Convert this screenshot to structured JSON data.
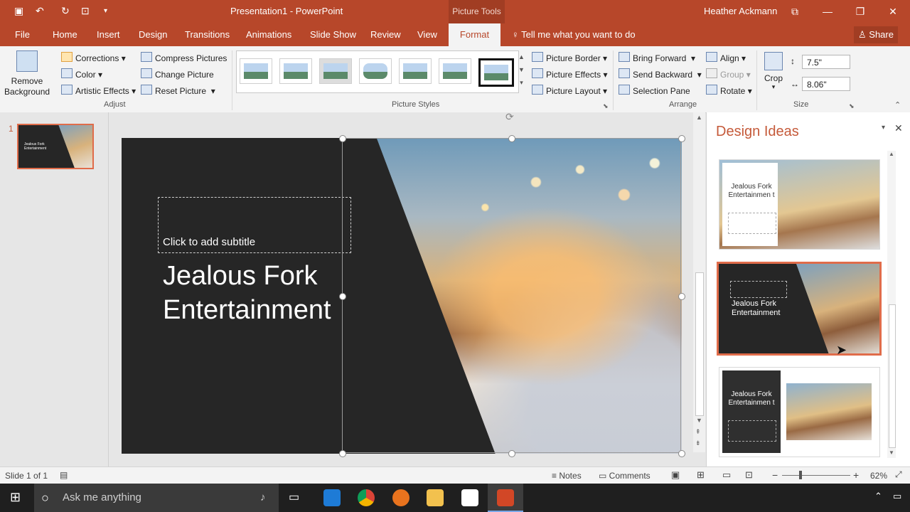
{
  "window": {
    "doc_title": "Presentation1 - PowerPoint",
    "context_tab": "Picture Tools",
    "user": "Heather Ackmann"
  },
  "tabs": [
    "File",
    "Home",
    "Insert",
    "Design",
    "Transitions",
    "Animations",
    "Slide Show",
    "Review",
    "View",
    "Format"
  ],
  "tell_me": "Tell me what you want to do",
  "share_label": "Share",
  "ribbon": {
    "remove_background": "Remove Background",
    "adjust": {
      "corrections": "Corrections",
      "color": "Color",
      "artistic_effects": "Artistic Effects",
      "compress": "Compress Pictures",
      "change": "Change Picture",
      "reset": "Reset Picture",
      "label": "Adjust"
    },
    "styles_label": "Picture Styles",
    "picture_border": "Picture Border",
    "picture_effects": "Picture Effects",
    "picture_layout": "Picture Layout",
    "arrange": {
      "bring_forward": "Bring Forward",
      "send_backward": "Send Backward",
      "selection_pane": "Selection Pane",
      "align": "Align",
      "group": "Group",
      "rotate": "Rotate",
      "label": "Arrange"
    },
    "size": {
      "crop": "Crop",
      "height": "7.5\"",
      "width": "8.06\"",
      "label": "Size"
    }
  },
  "slides_pane": {
    "slide_number": "1"
  },
  "slide": {
    "subtitle_placeholder": "Click to add subtitle",
    "title_line1": "Jealous Fork",
    "title_line2": "Entertainment"
  },
  "design_ideas": {
    "heading": "Design Ideas",
    "idea1_text": "Jealous Fork Entertainmen t",
    "idea2_text": "Jealous Fork Entertainment",
    "idea3_text": "Jealous Fork Entertainmen t"
  },
  "status": {
    "slide_info": "Slide 1 of 1",
    "notes": "Notes",
    "comments": "Comments",
    "zoom": "62%"
  },
  "taskbar": {
    "search_placeholder": "Ask me anything"
  },
  "colors": {
    "accent": "#b7472a",
    "design_accent": "#c55a3a"
  }
}
